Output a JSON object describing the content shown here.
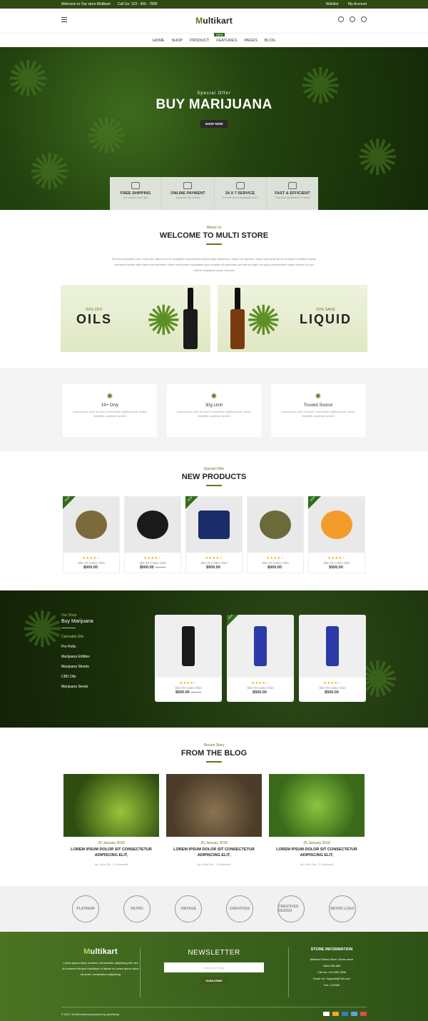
{
  "topbar": {
    "welcome": "Welcome to Our store Multikart",
    "call": "Call Us: 123 - 456 - 7890",
    "wishlist": "Wishlist",
    "account": "My Account"
  },
  "header": {
    "logo_m": "M",
    "logo_rest": "ultikart"
  },
  "nav": {
    "items": [
      "HOME",
      "SHOP",
      "PRODUCT",
      "FEATURES",
      "PAGES",
      "BLOG"
    ],
    "badge": "NEW"
  },
  "hero": {
    "sub": "Special Offer",
    "title": "BUY MARIJUANA",
    "button": "SHOP NOW"
  },
  "features": [
    {
      "title": "FREE SHIPPING",
      "desc": "On Orders Over $50"
    },
    {
      "title": "ONLINE PAYMENT",
      "desc": "Instantly Pay Online"
    },
    {
      "title": "24 X 7 SERVICE",
      "desc": "Our Service Is Available 24X7"
    },
    {
      "title": "FAST & EFFICIENT",
      "desc": "Fast And Qualitative Product"
    }
  ],
  "about": {
    "sub": "About Us",
    "title": "WELCOME TO MULTI STORE",
    "text": "Sed ut perspiciatis unde omnis iste natus error sit voluptatem accusantium doloremque laudantium, totam rem aperiam, eaque ipsa quae ab illo inventore veritatis et quasi architecto beatae vitae dicta sunt explicabo. Nemo enim ipsam voluptatem quia voluptas sit aspernatur aut odit aut fugit, sed quia consequuntur magni dolores eos qui ratione voluptatem sequi nesciunt."
  },
  "banners": [
    {
      "promo": "50% OFF",
      "word": "OILS"
    },
    {
      "promo": "20% SAVE",
      "word": "LIQUID"
    }
  ],
  "limits": [
    {
      "title": "19+ Only",
      "desc": "Lorem ipsum dolor sit amet, consectetur adipiscing elit. Autem blanditiis cupiditate deleniti"
    },
    {
      "title": "30g Limit",
      "desc": "Lorem ipsum dolor sit amet, consectetur adipiscing elit. Autem blanditiis cupiditate deleniti"
    },
    {
      "title": "Trusted Source",
      "desc": "Lorem ipsum dolor sit amet, consectetur adipiscing elit. Autem blanditiis cupiditate deleniti"
    }
  ],
  "new_products": {
    "sub": "Special Offer",
    "title": "NEW PRODUCTS",
    "items": [
      {
        "name": "Slim Fit Cotton Shirt",
        "price": "$500.00",
        "old": "",
        "new": true
      },
      {
        "name": "Slim Fit Cotton Shirt",
        "price": "$500.00",
        "old": "$600.00",
        "new": false
      },
      {
        "name": "Slim Fit Cotton Shirt",
        "price": "$500.00",
        "old": "",
        "new": true
      },
      {
        "name": "Slim Fit Cotton Shirt",
        "price": "$500.00",
        "old": "",
        "new": false
      },
      {
        "name": "Slim Fit Cotton Shirt",
        "price": "$500.00",
        "old": "",
        "new": true
      }
    ]
  },
  "shop": {
    "sub": "Our Shop",
    "title": "Buy Marijuana",
    "categories": [
      "Cannabis Oils",
      "Pre Rolls",
      "Marijuana Edibles",
      "Marijuana Weeds",
      "CBD Oils",
      "Marijuana Seeds"
    ],
    "items": [
      {
        "name": "Slim Fit Cotton Shirt",
        "price": "$500.00",
        "old": "$600.00"
      },
      {
        "name": "Slim Fit Cotton Shirt",
        "price": "$500.00",
        "old": ""
      },
      {
        "name": "Slim Fit Cotton Shirt",
        "price": "$500.00",
        "old": ""
      }
    ]
  },
  "blog": {
    "sub": "Recent Story",
    "title": "FROM THE BLOG",
    "posts": [
      {
        "date": "25 January 2018",
        "title": "LOREM IPSUM DOLOR SIT CONSECTETUR ADIPISCING ELIT,",
        "author": "by: John Dio , 2 Comment"
      },
      {
        "date": "25 January 2018",
        "title": "LOREM IPSUM DOLOR SIT CONSECTETUR ADIPISCING ELIT,",
        "author": "by: John Dio , 2 Comment"
      },
      {
        "date": "25 January 2018",
        "title": "LOREM IPSUM DOLOR SIT CONSECTETUR ADIPISCING ELIT,",
        "author": "by: John Dio , 2 Comment"
      }
    ]
  },
  "brand_logos": [
    "PLATINUM",
    "RETRO",
    "VINTAGE",
    "CREATIVES",
    "CREATIVES DESIGN",
    "RETRO LOGO"
  ],
  "footer": {
    "logo_m": "M",
    "logo_rest": "ultikart",
    "about": "Lorem ipsum dolor sit amet, consectetur adipiscing elit, sed do eiusmod tempor incididunt ut labore et.Lorem ipsum dolor sit amet, consectetur adipiscing",
    "newsletter_title": "NEWSLETTER",
    "email_placeholder": "Enter your email",
    "subscribe": "SUBSCRIBE",
    "store_title": "STORE INFORMATION",
    "store_lines": [
      "Multikart Demo Store, Demo store",
      "India-345-659",
      "Call Us: 123-456-7898",
      "Email Us: Support@Fiot.com",
      "Fax: 123456"
    ],
    "copyright": "© 2017-18 themeforest powered by pixelstrap"
  },
  "colors": {
    "brand": "#5b7a1e",
    "dark_green": "#2f4a12"
  }
}
